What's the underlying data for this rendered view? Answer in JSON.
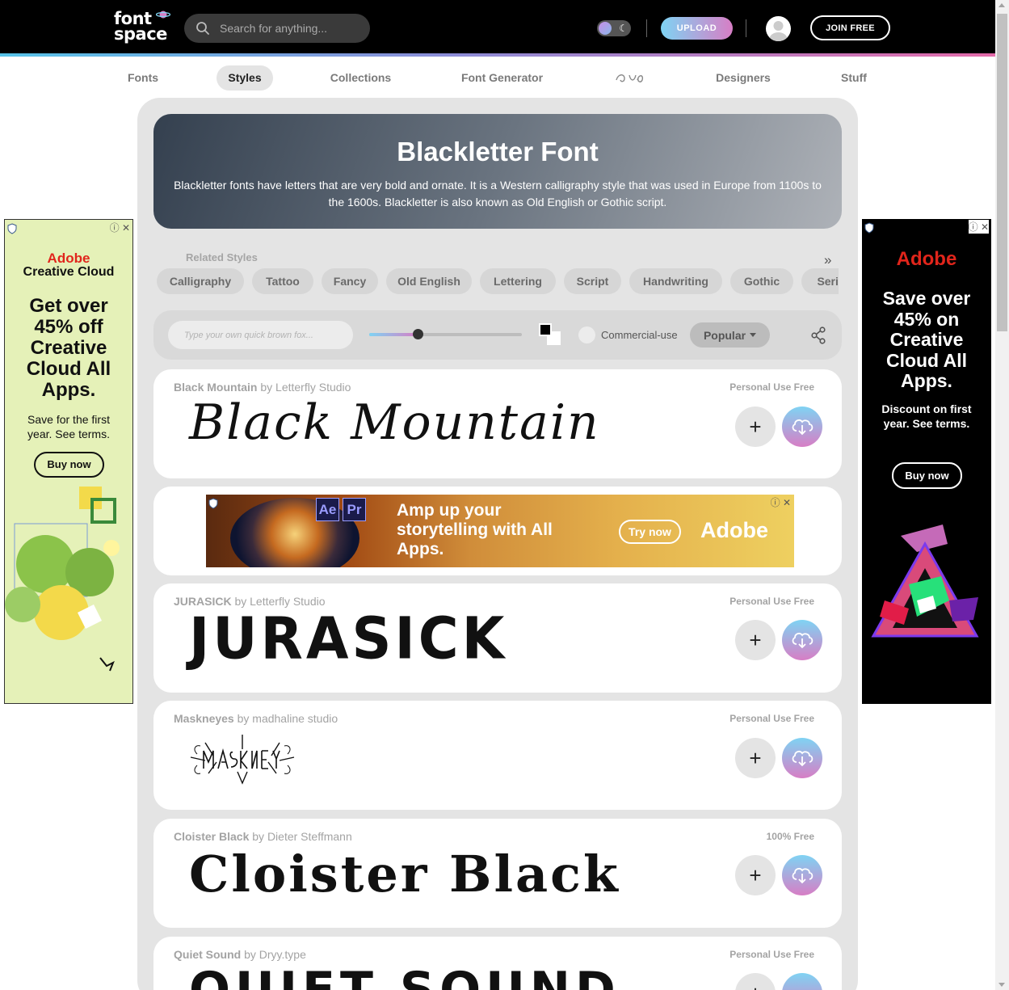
{
  "header": {
    "logo_line1": "font",
    "logo_line2": "space",
    "search_placeholder": "Search for anything...",
    "upload_label": "UPLOAD",
    "join_label": "JOIN FREE"
  },
  "nav": {
    "items": [
      {
        "label": "Fonts",
        "active": false
      },
      {
        "label": "Styles",
        "active": true
      },
      {
        "label": "Collections",
        "active": false
      },
      {
        "label": "Font Generator",
        "active": false
      },
      {
        "label": "",
        "icon": "glyph-icon"
      },
      {
        "label": "Designers",
        "active": false
      },
      {
        "label": "Stuff",
        "active": false
      }
    ]
  },
  "hero": {
    "title": "Blackletter Font",
    "description": "Blackletter fonts have letters that are very bold and ornate. It is a Western calligraphy style that was used in Europe from 1100s to the 1600s. Blackletter is also known as Old English or Gothic script."
  },
  "related": {
    "label": "Related Styles",
    "chips": [
      "Calligraphy",
      "Tattoo",
      "Fancy",
      "Old English",
      "Lettering",
      "Script",
      "Handwriting",
      "Gothic",
      "Serif"
    ]
  },
  "toolbar": {
    "preview_placeholder": "Type your own quick brown fox...",
    "commercial_label": "Commercial-use",
    "sort_label": "Popular",
    "size_slider_fraction": 0.32
  },
  "fonts": [
    {
      "name": "Black Mountain",
      "by": "by Letterfly Studio",
      "license": "Personal Use Free",
      "preview": "Black Mountain"
    },
    {
      "name": "JURASICK",
      "by": "by Letterfly Studio",
      "license": "Personal Use Free",
      "preview": "JURASICK"
    },
    {
      "name": "Maskneyes",
      "by": "by madhaline studio",
      "license": "Personal Use Free",
      "preview": "Maskneyes"
    },
    {
      "name": "Cloister Black",
      "by": "by Dieter Steffmann",
      "license": "100% Free",
      "preview": "Cloister Black"
    },
    {
      "name": "Quiet Sound",
      "by": "by Dryy.type",
      "license": "Personal Use Free",
      "preview": "QUIET SOUND"
    }
  ],
  "ads": {
    "left": {
      "brand": "Adobe",
      "product": "Creative Cloud",
      "headline": "Get over 45% off Creative Cloud All Apps.",
      "body": "Save for the first year. See terms.",
      "cta": "Buy now"
    },
    "right": {
      "brand": "Adobe",
      "headline": "Save over 45% on Creative Cloud All Apps.",
      "body": "Discount on first year. See terms.",
      "cta": "Buy now"
    },
    "banner": {
      "app1": "Ae",
      "app2": "Pr",
      "headline": "Amp up your storytelling with All Apps.",
      "cta": "Try now",
      "brand": "Adobe"
    }
  },
  "colors": {
    "accent_gradient_start": "#7fd3f3",
    "accent_gradient_end": "#d77ec5",
    "adobe_red": "#e1251b"
  }
}
